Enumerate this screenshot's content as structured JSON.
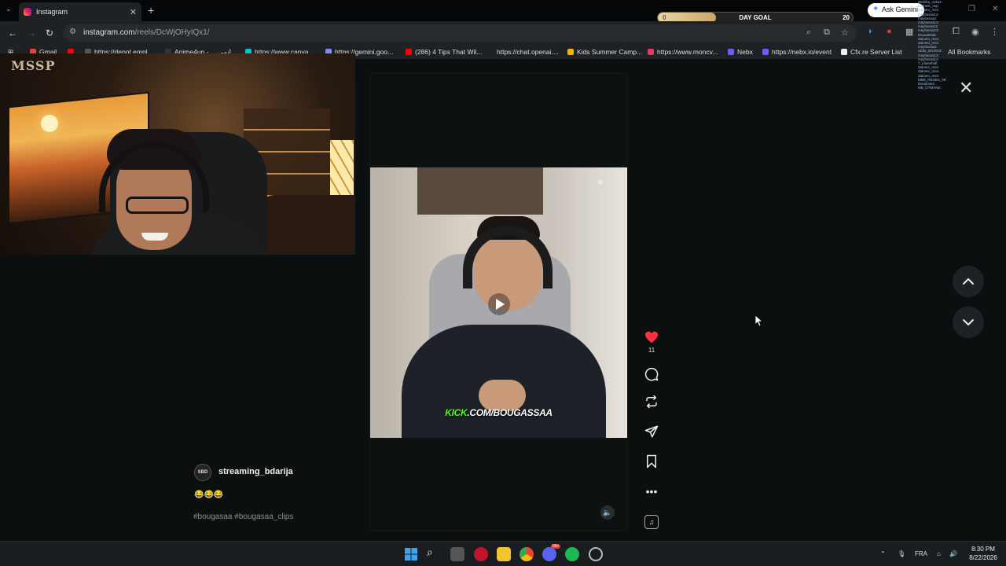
{
  "browser": {
    "tab_title": "Instagram",
    "url_host": "instagram.com",
    "url_path": "/reels/DcWjOHyIQx1/",
    "ask_gemini": "Ask Gemini",
    "bookmarks": [
      {
        "label": "Gmail",
        "color": "#ea4335"
      },
      {
        "label": "",
        "color": "#ff0000"
      },
      {
        "label": "https://depot.empl...",
        "color": "#555555"
      },
      {
        "label": "Anime4up - ... انمي",
        "color": "#333333"
      },
      {
        "label": "https://www.canva....",
        "color": "#00c4cc"
      },
      {
        "label": "https://gemini.goo...",
        "color": "#7b8cff"
      },
      {
        "label": "(286) 4 Tips That Wil...",
        "color": "#ff0000"
      },
      {
        "label": "https://chat.openai....",
        "color": "#222222"
      },
      {
        "label": "Kids Summer Camp...",
        "color": "#f4b400"
      },
      {
        "label": "https://www.moncv...",
        "color": "#e33b5b"
      },
      {
        "label": "Nebx",
        "color": "#6a5cff"
      },
      {
        "label": "https://nebx.io/event",
        "color": "#6a5cff"
      },
      {
        "label": "Cfx.re Server List",
        "color": "#f0f0f0"
      }
    ],
    "all_bookmarks": "All Bookmarks"
  },
  "overlay": {
    "day_goal_label": "DAY GOAL",
    "day_goal_start": "0",
    "day_goal_target": "20",
    "day_goal_progress": 0.3,
    "webcam_logo": "MSSP",
    "chat_lines": [
      "Wahiba_oukaz: ",
      "bsahtek_rwp: ",
      "Zalonto_mss: ",
      "mayhassa12: ",
      "mayhassa2: ",
      "mayhassa12: ",
      "mayhassa11: ",
      "mayhassa13: ",
      "Dsuaalelab: ",
      "Zalonto_mss: ",
      "Zalonto_mss: ",
      "mayhassa2: ",
      "Abdu_BO2019: ",
      "mayhassa13: ",
      "mayhassa12: ",
      "7_Lbaseball: ",
      "Zalonto_mss: ",
      "Zalonto_mss: ",
      "Zalonto_mss: ",
      "MBB_REDES_99: ",
      "karadoves: ",
      "MB_OTMANE: "
    ]
  },
  "reel": {
    "caption_green": "KICK",
    "caption_white": ".COM/BOUGASSAA",
    "likes": "11",
    "username": "streaming_bdarija",
    "avatar_text": "SBD",
    "emojis": "😂😂😂",
    "hashtags": "#bougasaa #bougasaa_clips"
  },
  "taskbar": {
    "language": "FRA",
    "time": "8:30 PM",
    "date": "8/22/2026",
    "discord_badge": "99+"
  }
}
